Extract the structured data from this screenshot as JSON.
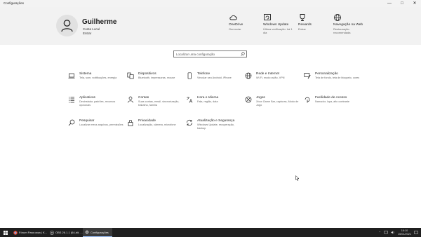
{
  "window": {
    "title": "Configurações"
  },
  "window_controls": [
    "—",
    "□",
    "✕"
  ],
  "account": {
    "name": "Guilherme",
    "type": "Conta Local",
    "signin": "Entrar"
  },
  "header_items": [
    {
      "title": "OneDrive",
      "subtitle": "Gerenciar",
      "icon": "onedrive-cloud-icon"
    },
    {
      "title": "Windows Update",
      "subtitle": "Última verificação: há 1 dia",
      "icon": "windows-update-icon"
    },
    {
      "title": "Rewards",
      "subtitle": "Entrar",
      "icon": "rewards-trophy-icon"
    },
    {
      "title": "Navegação na Web",
      "subtitle": "Restauração recomendada",
      "icon": "globe-icon"
    }
  ],
  "search": {
    "placeholder": "Localizar uma configuração"
  },
  "categories": [
    {
      "title": "Sistema",
      "desc": "Tela, som, notificações, energia",
      "icon": "laptop-icon"
    },
    {
      "title": "Dispositivos",
      "desc": "Bluetooth, impressoras, mouse",
      "icon": "keyboard-icon"
    },
    {
      "title": "Telefone",
      "desc": "Vincular seu Android, iPhone",
      "icon": "phone-icon"
    },
    {
      "title": "Rede e Internet",
      "desc": "Wi-Fi, modo avião, VPN",
      "icon": "globe-network-icon"
    },
    {
      "title": "Personalização",
      "desc": "Tela de fundo, tela de bloqueio, cores",
      "icon": "paintbrush-icon"
    },
    {
      "title": "Aplicativos",
      "desc": "Desinstalar, padrões, recursos opcionais",
      "icon": "apps-list-icon"
    },
    {
      "title": "Contas",
      "desc": "Suas contas, email, sincronização, trabalho, família",
      "icon": "person-icon"
    },
    {
      "title": "Hora e Idioma",
      "desc": "Fala, região, data",
      "icon": "time-language-icon"
    },
    {
      "title": "Jogos",
      "desc": "Xbox Game Bar, capturas, Modo de Jogo",
      "icon": "xbox-icon"
    },
    {
      "title": "Facilidade de Acesso",
      "desc": "Narrador, lupa, alto contraste",
      "icon": "ease-of-access-icon"
    },
    {
      "title": "Pesquisar",
      "desc": "Localizar meus arquivos, permissões",
      "icon": "search-icon"
    },
    {
      "title": "Privacidade",
      "desc": "Localização, câmera, microfone",
      "icon": "lock-icon"
    },
    {
      "title": "Atualização e Segurança",
      "desc": "Windows Update, recuperação, backup",
      "icon": "update-sync-icon"
    }
  ],
  "taskbar": {
    "items": [
      {
        "label": "Fórum Para casa | K...",
        "icon": "chrome-icon"
      },
      {
        "label": "OBS 26.1.1 (64-bit, ...",
        "icon": "obs-icon"
      },
      {
        "label": "Configurações",
        "icon": "settings-gear-icon"
      }
    ],
    "time": "16:10",
    "date": "15/01/2021"
  },
  "colors": {
    "accent": "#0067c0",
    "header_bg": "#f2f2f2",
    "taskbar_bg": "#1f1f1f"
  }
}
